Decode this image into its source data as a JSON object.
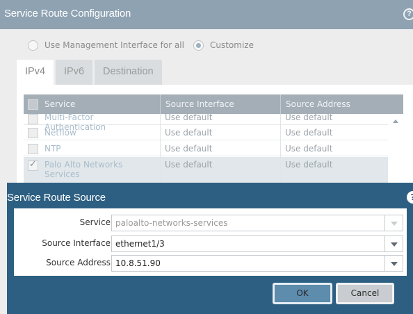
{
  "background_dialog": {
    "title": "Service Route Configuration",
    "help_icon": "?",
    "radio_options": [
      {
        "label": "Use Management Interface for all",
        "checked": false
      },
      {
        "label": "Customize",
        "checked": true
      }
    ],
    "tabs": [
      {
        "label": "IPv4",
        "active": true
      },
      {
        "label": "IPv6",
        "active": false
      },
      {
        "label": "Destination",
        "active": false
      }
    ],
    "table": {
      "columns": [
        "Service",
        "Source Interface",
        "Source Address"
      ],
      "rows": [
        {
          "service": "Multi-Factor Authentication",
          "source_interface": "Use default",
          "source_address": "Use default",
          "checked": false
        },
        {
          "service": "Netflow",
          "source_interface": "Use default",
          "source_address": "Use default",
          "checked": false
        },
        {
          "service": "NTP",
          "source_interface": "Use default",
          "source_address": "Use default",
          "checked": false
        },
        {
          "service": "Palo Alto Networks Services",
          "source_interface": "Use default",
          "source_address": "Use default",
          "checked": true
        }
      ]
    }
  },
  "modal": {
    "title": "Service Route Source",
    "help_icon": "?",
    "fields": {
      "service": {
        "label": "Service",
        "value": "paloalto-networks-services",
        "disabled": true
      },
      "source_interface": {
        "label": "Source Interface",
        "value": "ethernet1/3"
      },
      "source_address": {
        "label": "Source Address",
        "value": "10.8.51.90"
      }
    },
    "buttons": {
      "ok": "OK",
      "cancel": "Cancel"
    }
  },
  "colors": {
    "modal_bg": "#2d5f82",
    "background_header": "#8ea2b2",
    "ok_button": "#5d8cad"
  }
}
